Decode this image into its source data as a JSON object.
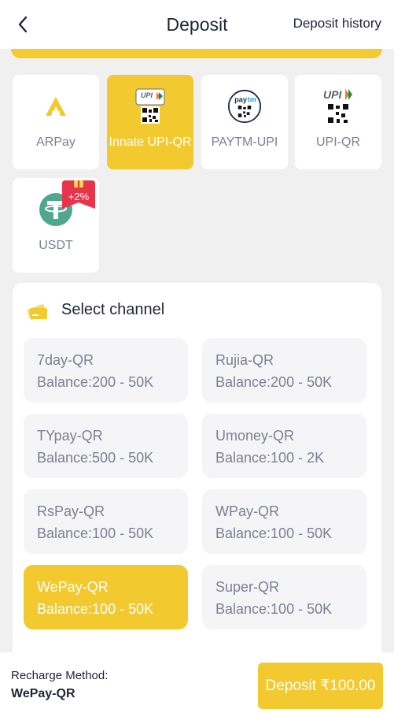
{
  "header": {
    "title": "Deposit",
    "history_label": "Deposit history"
  },
  "methods": [
    {
      "label": "ARPay",
      "icon": "arpay-logo-icon",
      "active": false
    },
    {
      "label": "Innate UPI-QR",
      "icon": "upi-qr-icon",
      "active": true
    },
    {
      "label": "PAYTM-UPI",
      "icon": "paytm-qr-icon",
      "active": false
    },
    {
      "label": "UPI-QR",
      "icon": "upi-qr-icon",
      "active": false
    },
    {
      "label": "USDT",
      "icon": "tether-icon",
      "active": false,
      "badge": "+2%"
    }
  ],
  "channel_section": {
    "title": "Select channel",
    "icon": "wallet-card-icon"
  },
  "channels": [
    {
      "name": "7day-QR",
      "balance": "Balance:200 - 50K",
      "active": false
    },
    {
      "name": "Rujia-QR",
      "balance": "Balance:200 - 50K",
      "active": false
    },
    {
      "name": "TYpay-QR",
      "balance": "Balance:500 - 50K",
      "active": false
    },
    {
      "name": "Umoney-QR",
      "balance": "Balance:100 - 2K",
      "active": false
    },
    {
      "name": "RsPay-QR",
      "balance": "Balance:100 - 50K",
      "active": false
    },
    {
      "name": "WPay-QR",
      "balance": "Balance:100 - 50K",
      "active": false
    },
    {
      "name": "WePay-QR",
      "balance": "Balance:100 - 50K",
      "active": true
    },
    {
      "name": "Super-QR",
      "balance": "Balance:100 - 50K",
      "active": false
    }
  ],
  "footer": {
    "method_label": "Recharge Method:",
    "method_value": "WePay-QR",
    "deposit_button": "Deposit ₹100.00"
  },
  "colors": {
    "accent": "#f2c92f",
    "text_dark": "#1e2637",
    "text_muted": "#7b8094",
    "badge_red": "#e8344a"
  }
}
